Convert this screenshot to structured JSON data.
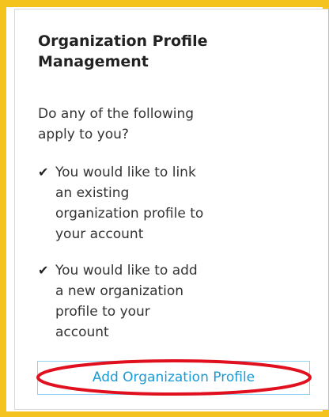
{
  "panel": {
    "title": "Organization Profile Management",
    "intro": "Do any of the following apply to you?",
    "options": [
      {
        "icon": "checkmark-icon",
        "text": "You would like to link an existing organization profile to your account"
      },
      {
        "icon": "checkmark-icon",
        "text": "You would like to add a new organization profile to your account"
      }
    ],
    "add_button_label": "Add Organization Profile"
  },
  "colors": {
    "frame_border": "#f5c31d",
    "button_text": "#1a9ad6",
    "button_border": "#8fd3f0",
    "annotation_ellipse": "#e0101e"
  }
}
